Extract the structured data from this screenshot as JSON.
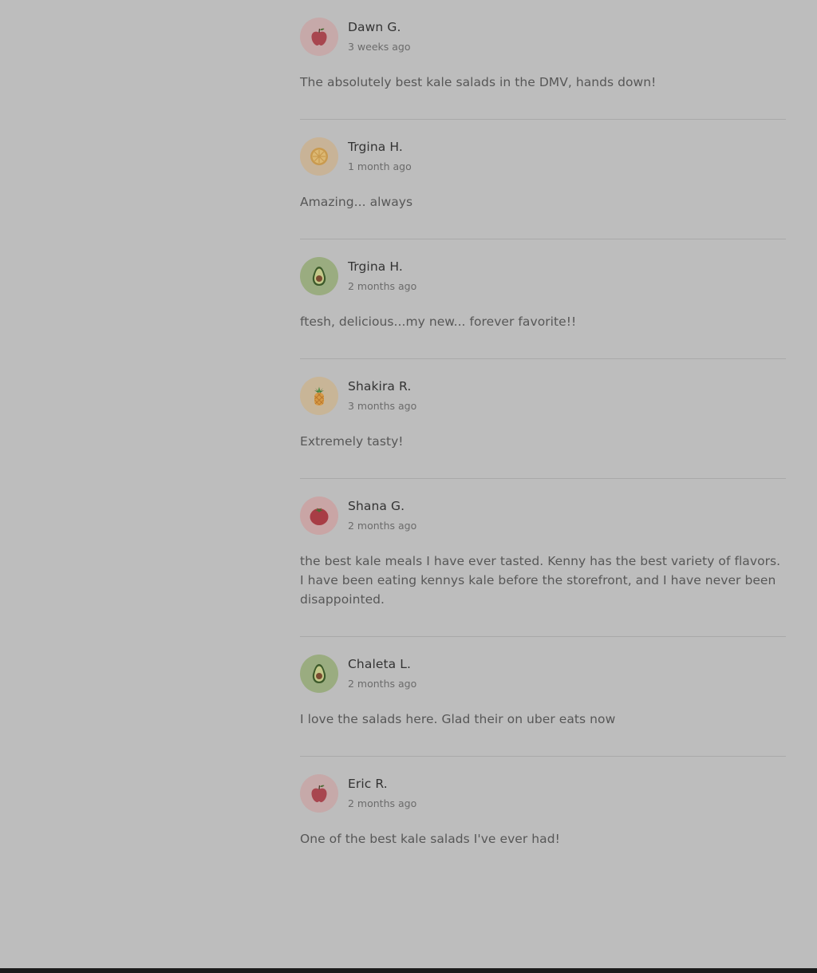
{
  "reviews": [
    {
      "name": "Dawn G.",
      "time": "3 weeks ago",
      "text": "The absolutely best kale salads in the DMV, hands down!",
      "avatar_icon": "apple-icon"
    },
    {
      "name": "Trgina H.",
      "time": "1 month ago",
      "text": "Amazing... always",
      "avatar_icon": "orange-slice-icon"
    },
    {
      "name": "Trgina H.",
      "time": "2 months ago",
      "text": "ftesh, delicious...my new... forever favorite!!",
      "avatar_icon": "avocado-icon"
    },
    {
      "name": "Shakira R.",
      "time": "3 months ago",
      "text": "Extremely tasty!",
      "avatar_icon": "pineapple-icon"
    },
    {
      "name": "Shana G.",
      "time": "2 months ago",
      "text": "the best kale meals I have ever tasted. Kenny has the best variety of flavors. I have been eating kennys kale before the storefront, and I have never been disappointed.",
      "avatar_icon": "tomato-icon"
    },
    {
      "name": "Chaleta L.",
      "time": "2 months ago",
      "text": "I love the salads here. Glad their on uber eats now",
      "avatar_icon": "avocado-icon"
    },
    {
      "name": "Eric R.",
      "time": "2 months ago",
      "text": "One of the best kale salads I've ever had!",
      "avatar_icon": "apple-icon"
    }
  ],
  "colors": {
    "overlay_background": "#bdbdbd",
    "name_text": "#333333",
    "body_text": "#575757",
    "divider": "#a9a9a9"
  }
}
